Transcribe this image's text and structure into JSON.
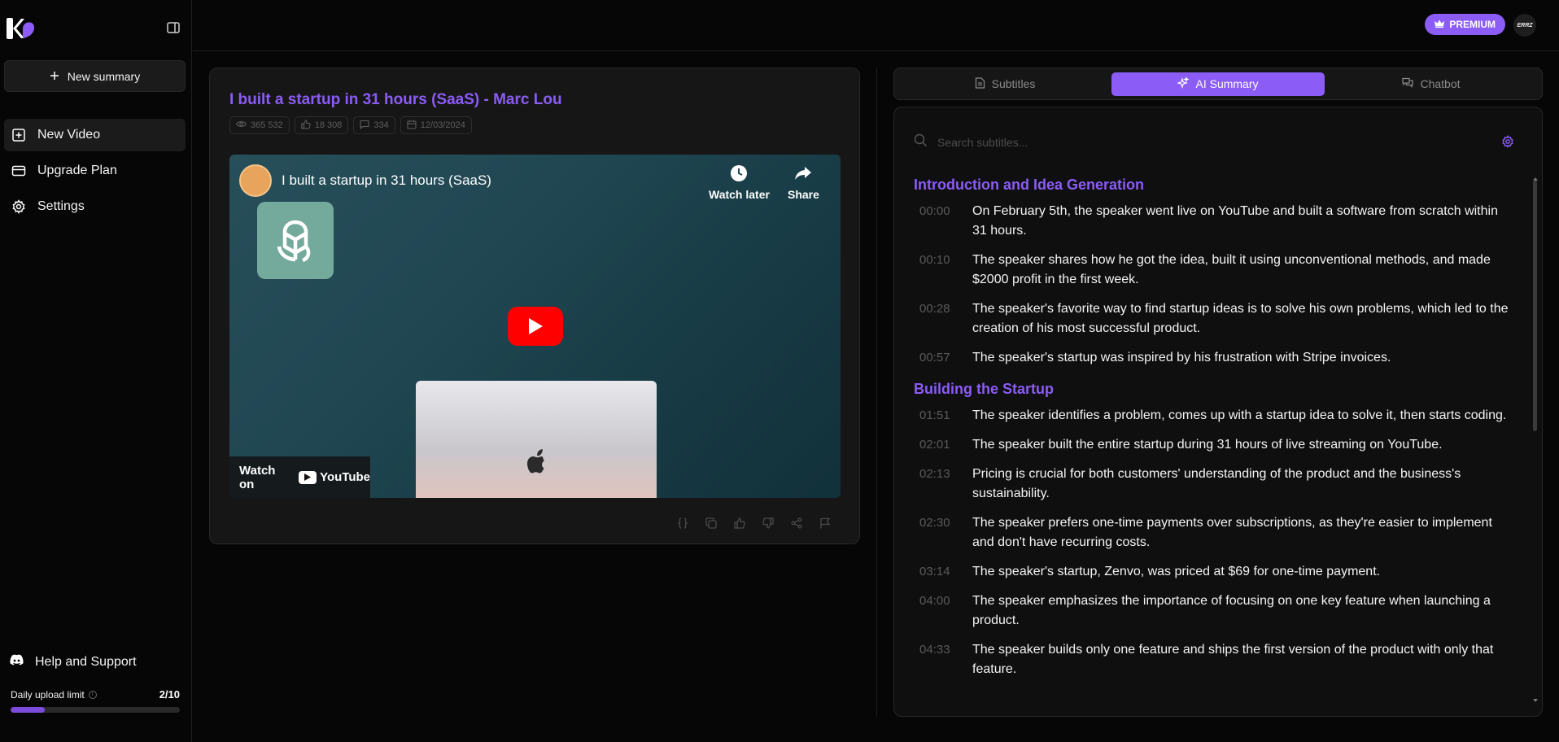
{
  "sidebar": {
    "new_summary_label": "New summary",
    "items": [
      {
        "label": "New Video",
        "icon": "plus-square-icon"
      },
      {
        "label": "Upgrade Plan",
        "icon": "credit-card-icon"
      },
      {
        "label": "Settings",
        "icon": "gear-icon"
      }
    ],
    "help_label": "Help and Support",
    "upload_label": "Daily upload limit",
    "upload_count": "2/10",
    "upload_fraction": 0.2
  },
  "topbar": {
    "premium_label": "PREMIUM",
    "avatar_text": "ERRZ"
  },
  "video": {
    "title": "I built a startup in 31 hours (SaaS) - Marc Lou",
    "views": "365 532",
    "likes": "18 308",
    "comments": "334",
    "date": "12/03/2024",
    "embed_title": "I built a startup in 31 hours (SaaS)",
    "watch_later": "Watch later",
    "share": "Share",
    "watch_on": "Watch on",
    "youtube": "YouTube"
  },
  "tabs": [
    {
      "label": "Subtitles",
      "icon": "document-icon"
    },
    {
      "label": "AI Summary",
      "icon": "sparkles-icon"
    },
    {
      "label": "Chatbot",
      "icon": "chat-icon"
    }
  ],
  "search": {
    "placeholder": "Search subtitles..."
  },
  "sections": [
    {
      "title": "Introduction and Idea Generation",
      "entries": [
        {
          "time": "00:00",
          "text": "On February 5th, the speaker went live on YouTube and built a software from scratch within 31 hours."
        },
        {
          "time": "00:10",
          "text": "The speaker shares how he got the idea, built it using unconventional methods, and made $2000 profit in the first week."
        },
        {
          "time": "00:28",
          "text": "The speaker's favorite way to find startup ideas is to solve his own problems, which led to the creation of his most successful product."
        },
        {
          "time": "00:57",
          "text": "The speaker's startup was inspired by his frustration with Stripe invoices."
        }
      ]
    },
    {
      "title": "Building the Startup",
      "entries": [
        {
          "time": "01:51",
          "text": "The speaker identifies a problem, comes up with a startup idea to solve it, then starts coding."
        },
        {
          "time": "02:01",
          "text": "The speaker built the entire startup during 31 hours of live streaming on YouTube."
        },
        {
          "time": "02:13",
          "text": "Pricing is crucial for both customers' understanding of the product and the business's sustainability."
        },
        {
          "time": "02:30",
          "text": "The speaker prefers one-time payments over subscriptions, as they're easier to implement and don't have recurring costs."
        },
        {
          "time": "03:14",
          "text": "The speaker's startup, Zenvo, was priced at $69 for one-time payment."
        },
        {
          "time": "04:00",
          "text": "The speaker emphasizes the importance of focusing on one key feature when launching a product."
        },
        {
          "time": "04:33",
          "text": "The speaker builds only one feature and ships the first version of the product with only that feature."
        }
      ]
    }
  ],
  "colors": {
    "accent": "#8b5cf6",
    "background": "#060606",
    "card": "#161616"
  }
}
